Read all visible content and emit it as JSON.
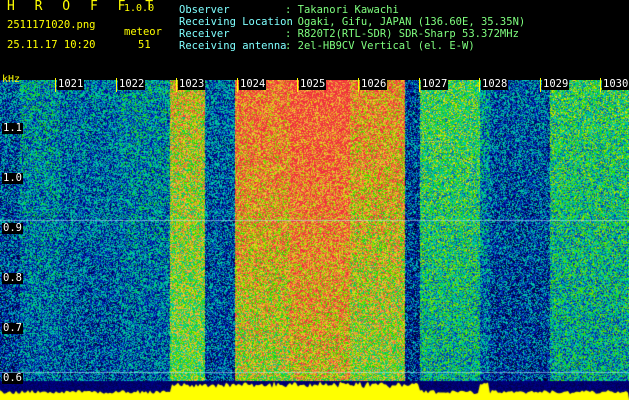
{
  "app": {
    "title": "H R O F F T",
    "version": "1.0.0",
    "file_name": "2511171020.png",
    "meteor_label": "meteor",
    "date_time": "25.11.17 10:20",
    "meteor_count": "51"
  },
  "info": [
    {
      "label": "Observer",
      "value": ": Takanori Kawachi"
    },
    {
      "label": "Receiving Location",
      "value": ": Ogaki, Gifu, JAPAN (136.60E, 35.35N)"
    },
    {
      "label": "Receiver",
      "value": ": R820T2(RTL-SDR) SDR-Sharp 53.372MHz"
    },
    {
      "label": "Receiving antenna",
      "value": ": 2el-HB9CV Vertical (el. E-W)"
    }
  ],
  "time_axis": {
    "unit_label": "kHz",
    "labels": [
      "1021",
      "1022",
      "1023",
      "1024",
      "1025",
      "1026",
      "1027",
      "1028",
      "1029",
      "1030"
    ]
  },
  "freq_axis": {
    "labels": [
      "1.1",
      "1.0",
      "0.9",
      "0.8",
      "0.7",
      "0.6"
    ]
  },
  "colors": {
    "header_text": "#ffff00",
    "info_label": "#7fffff",
    "info_value": "#7fff7f",
    "baseline": "#ffff00",
    "background": "#000000"
  }
}
